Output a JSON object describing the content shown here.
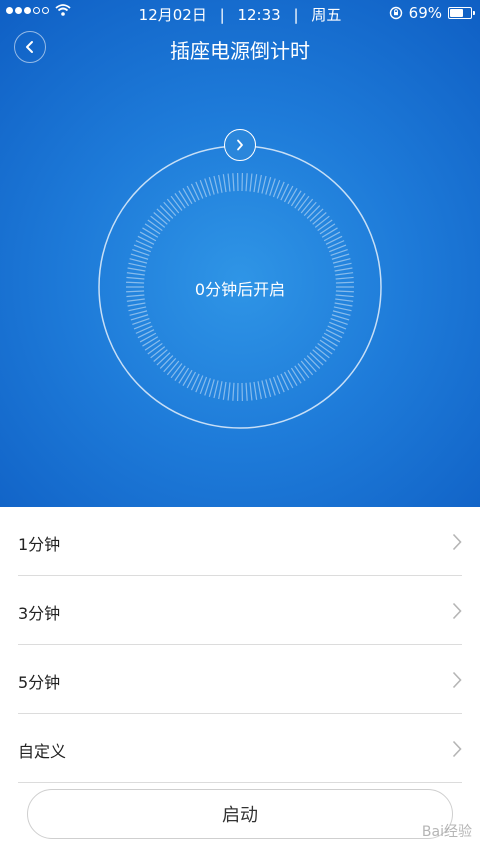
{
  "status_bar": {
    "signal_dots_filled": 3,
    "signal_dots_total": 5,
    "date": "12月02日",
    "time": "12:33",
    "weekday": "周五",
    "battery_percent": "69%",
    "battery_level": 0.69,
    "separator": "|"
  },
  "header": {
    "title": "插座电源倒计时",
    "back_icon": "chevron-left-icon"
  },
  "dial": {
    "status_text": "0分钟后开启",
    "next_icon": "chevron-right-icon"
  },
  "options": [
    {
      "label": "1分钟"
    },
    {
      "label": "3分钟"
    },
    {
      "label": "5分钟"
    },
    {
      "label": "自定义"
    }
  ],
  "start_button": {
    "label": "启动"
  },
  "watermark": {
    "text": "Bai经验"
  },
  "colors": {
    "hero_blue": "#1e7bd9",
    "list_divider": "#dcdcdc",
    "chevron_gray": "#b5b5b5"
  }
}
